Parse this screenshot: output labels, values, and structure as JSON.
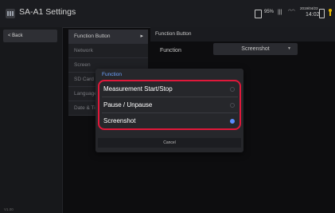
{
  "header": {
    "title": "SA-A1 Settings",
    "status": {
      "battery_percent": "95%",
      "date": "2019/04/23",
      "time": "14:02"
    }
  },
  "left": {
    "back_label": "< Back",
    "version": "V1.00"
  },
  "menu": {
    "items": [
      {
        "label": "Function Button"
      },
      {
        "label": "Network"
      },
      {
        "label": "Screen"
      },
      {
        "label": "SD Card"
      },
      {
        "label": "Language"
      },
      {
        "label": "Date & Time"
      }
    ]
  },
  "detail": {
    "header": "Function Button",
    "row_label": "Function",
    "row_value": "Screenshot"
  },
  "dialog": {
    "title": "Function",
    "options": [
      {
        "label": "Measurement Start/Stop",
        "selected": false
      },
      {
        "label": "Pause / Unpause",
        "selected": false
      },
      {
        "label": "Screenshot",
        "selected": true
      }
    ],
    "cancel_label": "Cancel"
  },
  "colors": {
    "accent": "#5b8cff",
    "highlight_border": "#e0183a"
  }
}
